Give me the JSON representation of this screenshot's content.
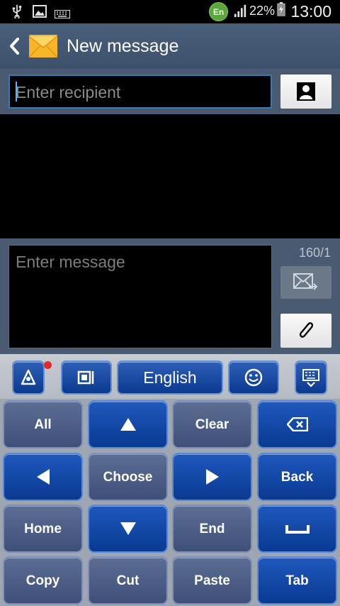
{
  "status_bar": {
    "language_badge": "En",
    "battery": "22%",
    "time": "13:00",
    "icons": [
      "usb-icon",
      "image-icon",
      "keyboard-icon",
      "signal-icon",
      "battery-icon"
    ]
  },
  "action_bar": {
    "title": "New message",
    "icons": [
      "back-arrow-icon",
      "envelope-icon"
    ]
  },
  "recipient": {
    "placeholder": "Enter recipient",
    "contact_icon": "contact-icon"
  },
  "compose": {
    "placeholder": "Enter message",
    "counter": "160/1",
    "send_icon": "send-icon",
    "attach_icon": "paperclip-icon"
  },
  "keyboard": {
    "language": "English",
    "tools": [
      "settings-icon",
      "layout-icon",
      "emoji-icon",
      "hide-keyboard-icon"
    ],
    "rows": [
      [
        "All",
        "up-arrow-icon",
        "Clear",
        "backspace-icon"
      ],
      [
        "left-arrow-icon",
        "Choose",
        "right-arrow-icon",
        "Back"
      ],
      [
        "Home",
        "down-arrow-icon",
        "End",
        "space-icon"
      ],
      [
        "Copy",
        "Cut",
        "Paste",
        "Tab"
      ]
    ],
    "labels": {
      "all": "All",
      "clear": "Clear",
      "choose": "Choose",
      "back": "Back",
      "home": "Home",
      "end": "End",
      "copy": "Copy",
      "cut": "Cut",
      "paste": "Paste",
      "tab": "Tab"
    }
  },
  "colors": {
    "action_bar": "#4a5f7a",
    "focus_border": "#2d7fb8",
    "key_blue": "#0a3a8f",
    "key_slate": "#4a5a80"
  }
}
